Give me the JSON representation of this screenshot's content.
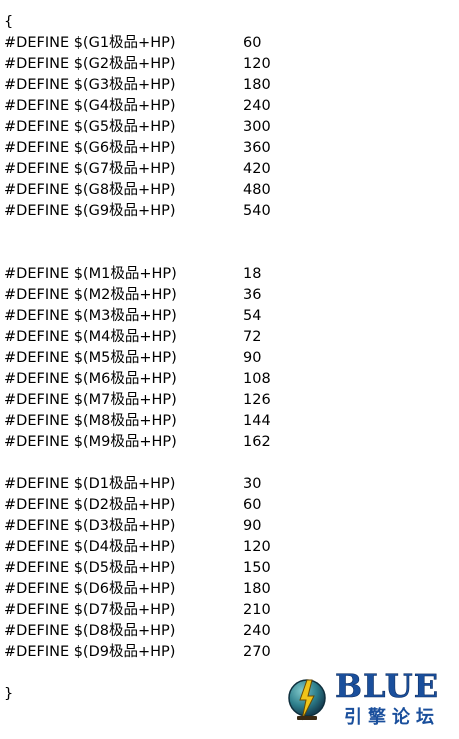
{
  "code": {
    "open_brace": "{",
    "close_brace": "}",
    "groups": [
      {
        "defines": [
          {
            "name": "#DEFINE $(G1极品+HP)",
            "value": "60"
          },
          {
            "name": "#DEFINE $(G2极品+HP)",
            "value": "120"
          },
          {
            "name": "#DEFINE $(G3极品+HP)",
            "value": "180"
          },
          {
            "name": "#DEFINE $(G4极品+HP)",
            "value": "240"
          },
          {
            "name": "#DEFINE $(G5极品+HP)",
            "value": "300"
          },
          {
            "name": "#DEFINE $(G6极品+HP)",
            "value": "360"
          },
          {
            "name": "#DEFINE $(G7极品+HP)",
            "value": "420"
          },
          {
            "name": "#DEFINE $(G8极品+HP)",
            "value": "480"
          },
          {
            "name": "#DEFINE $(G9极品+HP)",
            "value": "540"
          }
        ]
      },
      {
        "defines": [
          {
            "name": "#DEFINE $(M1极品+HP)",
            "value": "18"
          },
          {
            "name": "#DEFINE $(M2极品+HP)",
            "value": "36"
          },
          {
            "name": "#DEFINE $(M3极品+HP)",
            "value": "54"
          },
          {
            "name": "#DEFINE $(M4极品+HP)",
            "value": "72"
          },
          {
            "name": "#DEFINE $(M5极品+HP)",
            "value": "90"
          },
          {
            "name": "#DEFINE $(M6极品+HP)",
            "value": "108"
          },
          {
            "name": "#DEFINE $(M7极品+HP)",
            "value": "126"
          },
          {
            "name": "#DEFINE $(M8极品+HP)",
            "value": "144"
          },
          {
            "name": "#DEFINE $(M9极品+HP)",
            "value": "162"
          }
        ]
      },
      {
        "defines": [
          {
            "name": "#DEFINE $(D1极品+HP)",
            "value": "30"
          },
          {
            "name": "#DEFINE $(D2极品+HP)",
            "value": "60"
          },
          {
            "name": "#DEFINE $(D3极品+HP)",
            "value": "90"
          },
          {
            "name": "#DEFINE $(D4极品+HP)",
            "value": "120"
          },
          {
            "name": "#DEFINE $(D5极品+HP)",
            "value": "150"
          },
          {
            "name": "#DEFINE $(D6极品+HP)",
            "value": "180"
          },
          {
            "name": "#DEFINE $(D7极品+HP)",
            "value": "210"
          },
          {
            "name": "#DEFINE $(D8极品+HP)",
            "value": "240"
          },
          {
            "name": "#DEFINE $(D9极品+HP)",
            "value": "270"
          }
        ]
      }
    ]
  },
  "watermark": {
    "title": "BLUE",
    "subtitle": "引擎论坛",
    "icon": "blue-engine-logo-icon",
    "colors": {
      "brand_blue": "#1a4f9c",
      "emblem_teal": "#2e7f8c",
      "emblem_gold": "#f0c419"
    }
  }
}
